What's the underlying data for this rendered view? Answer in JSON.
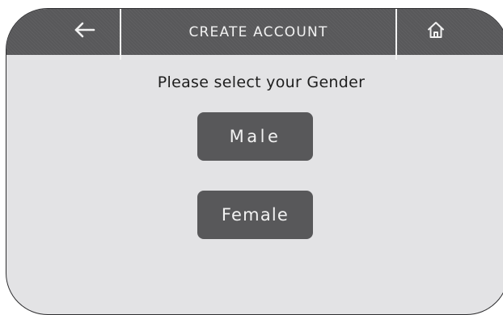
{
  "header": {
    "title": "CREATE ACCOUNT",
    "back_icon": "arrow-left-icon",
    "home_icon": "home-icon"
  },
  "prompt": "Please select your Gender",
  "options": [
    {
      "label": "Male"
    },
    {
      "label": "Female"
    }
  ],
  "colors": {
    "header": "#58585a",
    "background": "#e3e3e5",
    "button": "#58585a",
    "text_light": "#f2f2f2",
    "text_dark": "#1e1e1e"
  }
}
